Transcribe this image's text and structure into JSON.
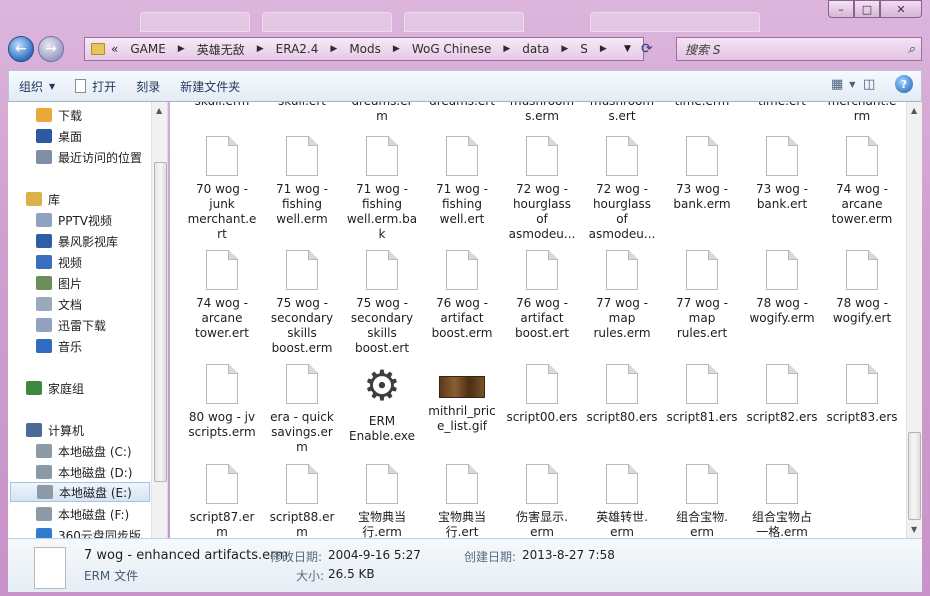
{
  "window": {
    "controls": {
      "minimize": "–",
      "maximize": "□",
      "close": "✕"
    }
  },
  "nav": {
    "back_glyph": "←",
    "forward_glyph": "→",
    "breadcrumb_lead": "«",
    "breadcrumbs": [
      "GAME",
      "英雄无敌",
      "ERA2.4",
      "Mods",
      "WoG Chinese",
      "data",
      "S"
    ],
    "search_placeholder": "搜索 S"
  },
  "toolbar": {
    "organize": "组织",
    "open": "打开",
    "burn": "刻录",
    "new_folder": "新建文件夹"
  },
  "sidebar": {
    "items": [
      {
        "label": "下载",
        "icon": "download-folder-icon",
        "color": "#e9a83a"
      },
      {
        "label": "桌面",
        "icon": "desktop-icon",
        "color": "#2c5aa0"
      },
      {
        "label": "最近访问的位置",
        "icon": "recent-places-icon",
        "color": "#7f8fa8"
      },
      {
        "label": "库",
        "icon": "library-icon",
        "color": "#d9b24a"
      },
      {
        "label": "PPTV视频",
        "icon": "library-video-icon",
        "color": "#8fa3c0"
      },
      {
        "label": "暴风影视库",
        "icon": "video-library-icon",
        "color": "#2d5fa6"
      },
      {
        "label": "视频",
        "icon": "video-icon",
        "color": "#3a6fbf"
      },
      {
        "label": "图片",
        "icon": "pictures-icon",
        "color": "#6b8e5a"
      },
      {
        "label": "文档",
        "icon": "documents-icon",
        "color": "#9aa8bd"
      },
      {
        "label": "迅雷下载",
        "icon": "thunder-download-icon",
        "color": "#8fa3c0"
      },
      {
        "label": "音乐",
        "icon": "music-icon",
        "color": "#2f6cc1"
      },
      {
        "label": "家庭组",
        "icon": "homegroup-icon",
        "color": "#3c8a3f"
      },
      {
        "label": "计算机",
        "icon": "computer-icon",
        "color": "#4a6b94"
      },
      {
        "label": "本地磁盘 (C:)",
        "icon": "drive-c-icon",
        "color": "#8c9aa8"
      },
      {
        "label": "本地磁盘 (D:)",
        "icon": "drive-d-icon",
        "color": "#8c9aa8"
      },
      {
        "label": "本地磁盘 (E:)",
        "icon": "drive-e-icon",
        "color": "#8c9aa8",
        "selected": true
      },
      {
        "label": "本地磁盘 (F:)",
        "icon": "drive-f-icon",
        "color": "#8c9aa8"
      },
      {
        "label": "360云盘同步版",
        "icon": "cloud-sync-icon",
        "color": "#2f7fd1"
      }
    ]
  },
  "files": {
    "row0": [
      "skull.erm",
      "skull.ert",
      "dreams.er\nm",
      "dreams.ert",
      "mushroom\ns.erm",
      "mushroom\ns.ert",
      "time.erm",
      "time.ert",
      "merchant.e\nrm"
    ],
    "row1": [
      "70 wog -\njunk\nmerchant.e\nrt",
      "71 wog -\nfishing\nwell.erm",
      "71 wog -\nfishing\nwell.erm.ba\nk",
      "71 wog -\nfishing\nwell.ert",
      "72 wog -\nhourglass\nof\nasmodeu...",
      "72 wog -\nhourglass\nof\nasmodeu...",
      "73 wog -\nbank.erm",
      "73 wog -\nbank.ert",
      "74 wog -\narcane\ntower.erm"
    ],
    "row2": [
      "74 wog -\narcane\ntower.ert",
      "75 wog -\nsecondary\nskills\nboost.erm",
      "75 wog -\nsecondary\nskills\nboost.ert",
      "76 wog -\nartifact\nboost.erm",
      "76 wog -\nartifact\nboost.ert",
      "77 wog -\nmap\nrules.erm",
      "77 wog -\nmap\nrules.ert",
      "78 wog -\nwogify.erm",
      "78 wog -\nwogify.ert"
    ],
    "row3": [
      "80 wog - jv\nscripts.erm",
      "era - quick\nsavings.er\nm",
      "ERM\nEnable.exe",
      "mithril_pric\ne_list.gif",
      "script00.ers",
      "script80.ers",
      "script81.ers",
      "script82.ers",
      "script83.ers"
    ],
    "row4": [
      "script87.er\nm",
      "script88.er\nm",
      "宝物典当\n行.erm",
      "宝物典当\n行.ert",
      "伤害显示.\nerm",
      "英雄转世.\nerm",
      "组合宝物.\nerm",
      "组合宝物占\n一格.erm"
    ]
  },
  "details": {
    "filename": "7 wog - enhanced artifacts.erm",
    "filetype": "ERM 文件",
    "modified_label": "修改日期:",
    "modified_value": "2004-9-16 5:27",
    "size_label": "大小:",
    "size_value": "26.5 KB",
    "created_label": "创建日期:",
    "created_value": "2013-8-27 7:58"
  }
}
